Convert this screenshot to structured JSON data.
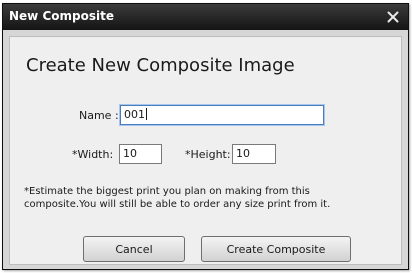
{
  "window": {
    "title": "New Composite",
    "close_icon": "close-icon"
  },
  "dialog": {
    "heading": "Create New Composite Image",
    "name_label": "Name :",
    "name_value": "001",
    "width_label": "*Width:",
    "width_value": "10",
    "height_label": "*Height:",
    "height_value": "10",
    "note_line1": "*Estimate the biggest print you plan on making from this",
    "note_line2": "composite.You will still be able to order any size print from it.",
    "cancel_label": "Cancel",
    "create_label": "Create Composite"
  }
}
